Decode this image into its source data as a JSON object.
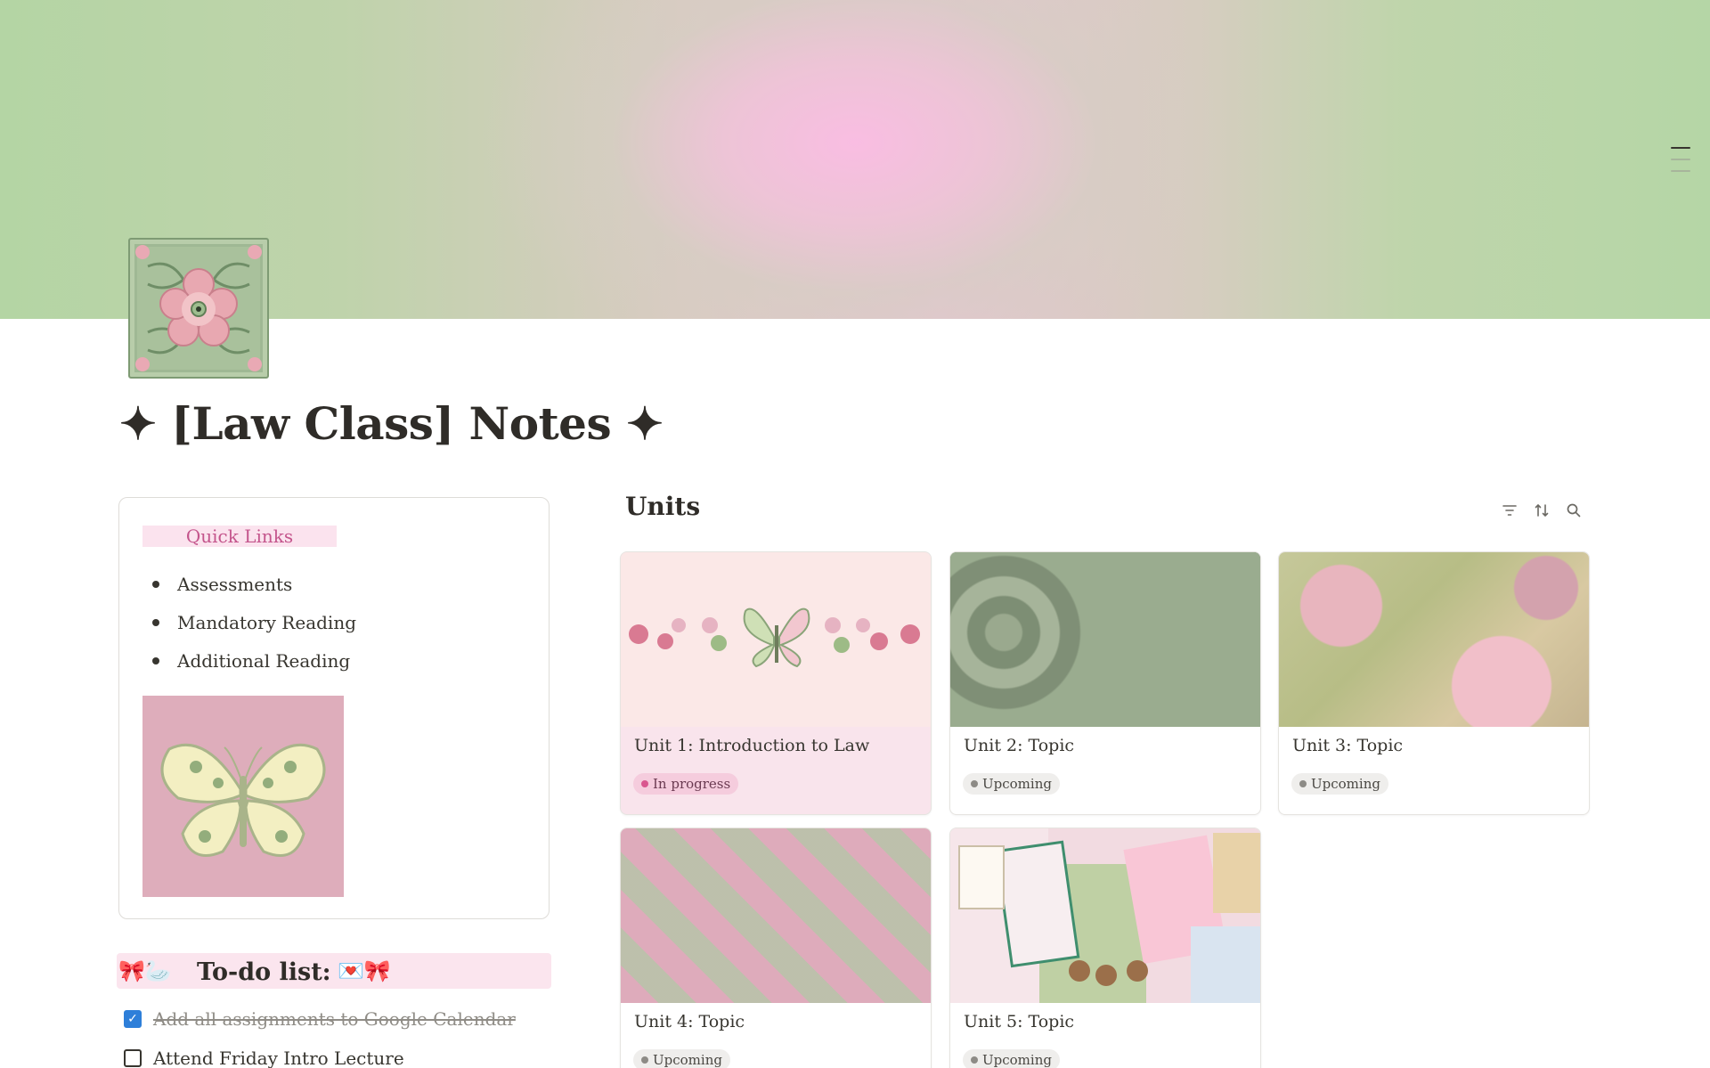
{
  "page": {
    "title": "✦ [Law Class] Notes ✦",
    "icon": "floral-tile-icon"
  },
  "quick_links": {
    "heading": "Quick Links",
    "items": [
      "Assessments",
      "Mandatory Reading",
      "Additional Reading"
    ],
    "image": "butterfly-image"
  },
  "todo": {
    "title": "To-do list:",
    "emoji_left": "🎀🦢",
    "emoji_right": "💌🎀",
    "items": [
      {
        "label": "Add all assignments to Google Calendar",
        "checked": true
      },
      {
        "label": "Attend Friday Intro Lecture",
        "checked": false
      }
    ]
  },
  "units": {
    "title": "Units",
    "tools": [
      "filter-icon",
      "sort-icon",
      "search-icon"
    ],
    "cards": [
      {
        "name": "Unit 1: Introduction to Law",
        "status": "In progress"
      },
      {
        "name": "Unit 2: Topic",
        "status": "Upcoming"
      },
      {
        "name": "Unit 3: Topic",
        "status": "Upcoming"
      },
      {
        "name": "Unit 4: Topic",
        "status": "Upcoming"
      },
      {
        "name": "Unit 5: Topic",
        "status": "Upcoming"
      }
    ]
  },
  "colors": {
    "cover_green": "#b4d5a4",
    "cover_pink": "#f9bde2",
    "highlight_pink": "#fbe3ee",
    "link_pink": "#c4558c",
    "checkbox_blue": "#2e7fd9",
    "in_progress": "#f5ccdd"
  }
}
